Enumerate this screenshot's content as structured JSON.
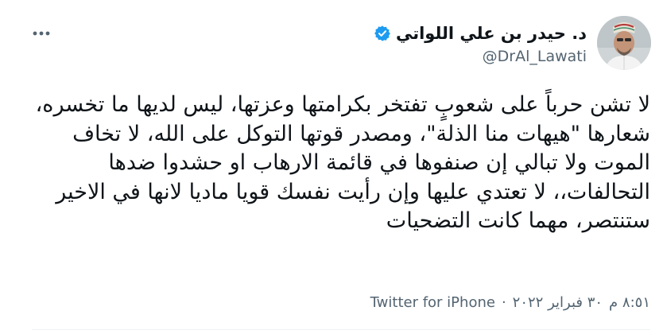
{
  "tweet": {
    "author": {
      "display_name": "د. حيدر بن علي اللواتي",
      "handle": "@DrAl_Lawati",
      "verified": true
    },
    "text": "لا تشن حرباً على شعوبٍ تفتخر بكرامتها وعزتها، ليس لديها ما تخسره، شعارها \"هيهات منا الذلة\"، ومصدر قوتها التوكل على الله، لا تخاف الموت ولا تبالي إن صنفوها في قائمة الارهاب او حشدوا ضدها التحالفات،، لا تعتدي عليها وإن رأيت نفسك قويا ماديا لانها في الاخير ستنتصر، مهما كانت التضحيات",
    "time": "٨:٥١ م",
    "date": "٣٠ فبراير ٢٠٢٢",
    "source": "Twitter for iPhone",
    "separator": "·"
  },
  "icons": {
    "more": "more-horizontal-icon",
    "verified": "verified-badge-icon"
  },
  "colors": {
    "text_primary": "#0f1419",
    "text_secondary": "#536471",
    "verified_blue": "#1d9bf0",
    "background": "#ffffff"
  }
}
